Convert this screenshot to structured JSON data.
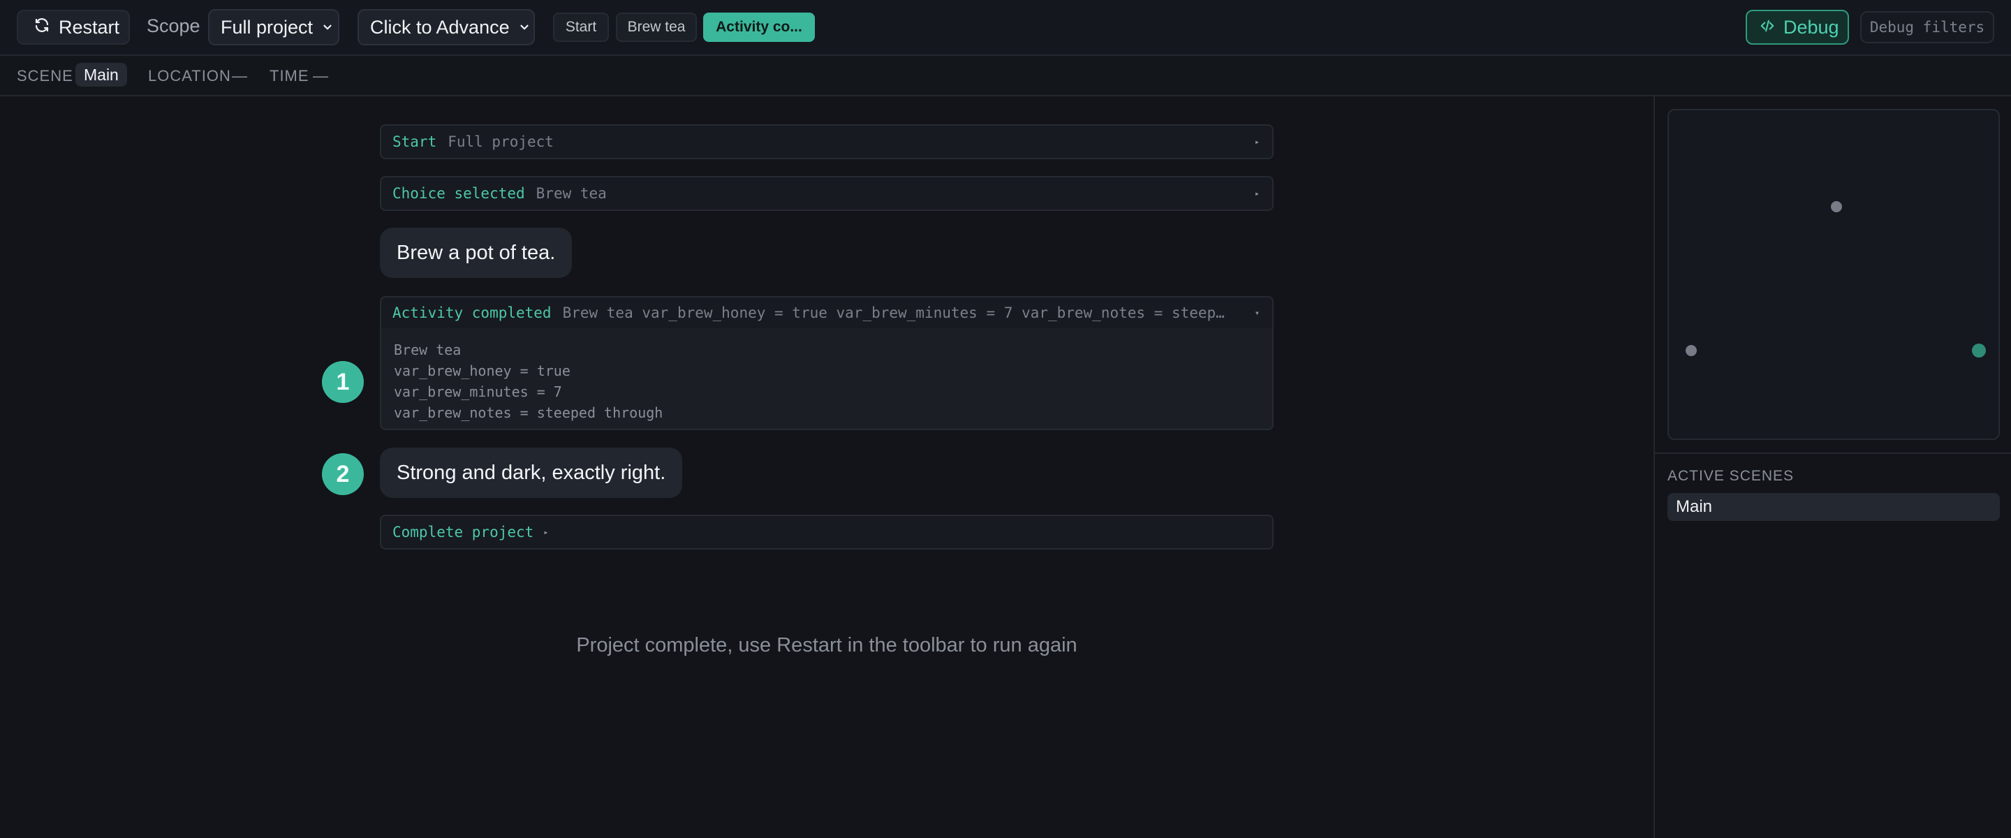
{
  "toolbar": {
    "restart_label": "Restart",
    "scope_label": "Scope",
    "scope_value": "Full project",
    "advance_value": "Click to Advance",
    "chips": [
      "Start",
      "Brew tea",
      "Activity co..."
    ],
    "debug_label": "Debug",
    "debug_filters_label": "Debug filters",
    "accent_color": "#3bb89c"
  },
  "scenebar": {
    "scene_label": "SCENE",
    "scene_value": "Main",
    "location_label": "LOCATION",
    "location_value": "—",
    "time_label": "TIME",
    "time_value": "—"
  },
  "log": {
    "start": {
      "key": "Start",
      "value": "Full project"
    },
    "choice": {
      "key": "Choice selected",
      "value": "Brew tea"
    },
    "bubble1": "Brew a pot of tea.",
    "activity": {
      "key": "Activity completed",
      "value": "Brew tea var_brew_honey = true var_brew_minutes = 7 var_brew_notes = steeped thro…",
      "details": [
        "Brew tea",
        "var_brew_honey = true",
        "var_brew_minutes = 7",
        "var_brew_notes = steeped through"
      ]
    },
    "step1": "1",
    "step2": "2",
    "bubble2": "Strong and dark, exactly right.",
    "complete_project": "Complete project",
    "complete_message": "Project complete, use Restart in the toolbar to run again"
  },
  "panel": {
    "active_scenes_title": "ACTIVE SCENES",
    "active_scenes": [
      "Main"
    ]
  }
}
